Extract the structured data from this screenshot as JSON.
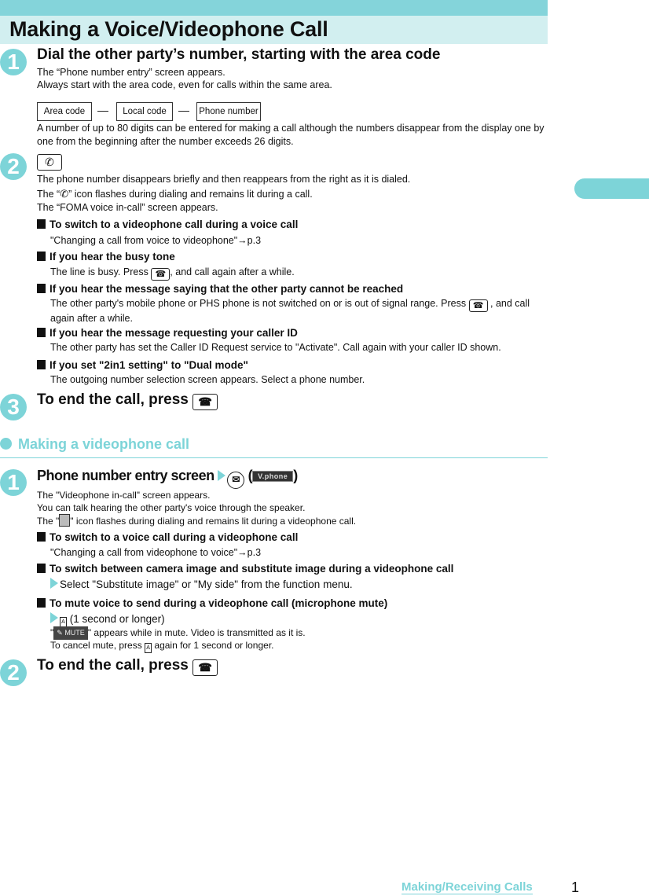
{
  "page": {
    "title": "Making a Voice/Videophone Call",
    "footer_link": "Making/Receiving Calls",
    "page_number": "1",
    "accent_color": "#7dd4d8"
  },
  "voice_steps": [
    {
      "number": "1",
      "title": "Dial the other party’s number, starting with the area code",
      "lines": [
        "The “Phone number entry” screen appears.",
        "Always start with the area code, even for calls within the same area."
      ],
      "number_format": [
        "Area code",
        "Local code",
        "Phone number"
      ],
      "separator": "—",
      "note": "A number of up to 80 digits can be entered for making a call although the numbers disappear from the display one by one from the beginning after the number exceeds 26 digits."
    },
    {
      "number": "2",
      "key_label": "✆",
      "lines": [
        "The phone number disappears briefly and then reappears from the right as it is dialed.",
        "The “",
        "” icon flashes during dialing and remains lit during a call.",
        "The “FOMA voice in-call” screen appears."
      ],
      "subsections": [
        {
          "heading": "To switch to a videophone call during a voice call",
          "text": "\"Changing a call from voice to videophone\"→p.3"
        },
        {
          "heading": "If you hear the busy tone",
          "text_a": "The line is busy. Press ",
          "text_b": ", and call again after a while."
        },
        {
          "heading": "If you hear the message saying that the other party cannot be reached",
          "text_a": "The other party's mobile phone or PHS phone is not switched on or is out of signal range. Press ",
          "text_b": " , and call again after a while."
        },
        {
          "heading": "If you hear the message requesting your caller ID",
          "text": "The other party has set the Caller ID Request service to \"Activate\". Call again with your caller ID shown."
        },
        {
          "heading": "If you set \"2in1 setting\" to \"Dual mode\"",
          "text": "The outgoing number selection screen appears. Select a phone number."
        }
      ]
    },
    {
      "number": "3",
      "title": "To end the call, press "
    }
  ],
  "video_section": {
    "heading": "Making a videophone call",
    "steps": [
      {
        "number": "1",
        "title": "Phone number entry screen",
        "softkey_label": "V.phone",
        "mail_glyph": "✉",
        "lines": [
          "The \"Videophone in-call\" screen appears.",
          "You can talk hearing the other party's voice through the speaker.",
          "The \"",
          "\" icon flashes during dialing and remains lit during a videophone call."
        ],
        "subsections": [
          {
            "heading": "To switch to a voice call during a videophone call",
            "text": "\"Changing a call from videophone to voice\"→p.3"
          },
          {
            "heading": "To switch between camera image and substitute image during a videophone call",
            "text": "Select \"Substitute image\" or \"My side\" from the function menu."
          },
          {
            "heading": "To mute voice to send during a videophone call (microphone mute)",
            "action": "(1 second or longer)",
            "mute_label": "MUTE",
            "mute_text_a": "\"",
            "mute_text_b": "\" appears while in mute. Video is transmitted as it is.",
            "cancel_a": "To cancel mute, press ",
            "cancel_b": " again for 1 second or longer.",
            "key_glyph": "A"
          }
        ]
      },
      {
        "number": "2",
        "title": "To end the call, press "
      }
    ]
  },
  "icons": {
    "phone_key": "☎"
  }
}
